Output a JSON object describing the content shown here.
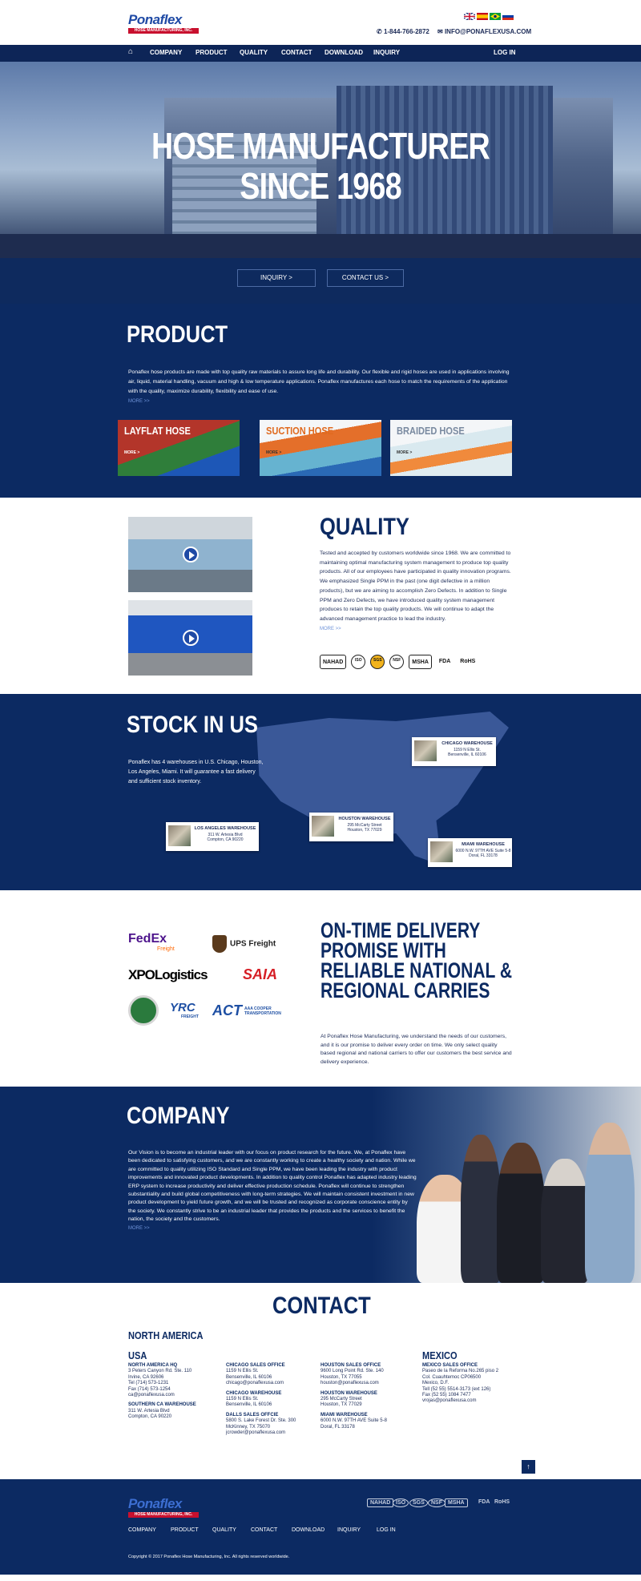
{
  "header": {
    "logo_brand": "Ponaflex",
    "logo_sub": "HOSE MANUFACTURING, INC.",
    "phone": "1-844-766-2872",
    "email": "INFO@PONAFLEXUSA.COM",
    "flags": [
      "uk",
      "spain",
      "brazil",
      "russia"
    ]
  },
  "nav": {
    "items": [
      "COMPANY",
      "PRODUCT",
      "QUALITY",
      "CONTACT",
      "DOWNLOAD",
      "INQUIRY"
    ],
    "login": "LOG IN"
  },
  "hero": {
    "line1": "HOSE MANUFACTURER",
    "line2": "SINCE 1968",
    "inquiry": "INQUIRY >",
    "contact": "CONTACT US >"
  },
  "product": {
    "title": "PRODUCT",
    "text": "Ponaflex hose products are made with top quality raw materials to assure long life and durability. Our flexible and rigid hoses are used in applications involving air, liquid, material handling, vacuum and high & low temperature applications. Ponaflex manufactures each hose to match the requirements of the application with the quality, maximize durability, flexibility and ease of use.",
    "more": "MORE >>",
    "cards": [
      {
        "label": "LAYFLAT HOSE",
        "more": "MORE >"
      },
      {
        "label": "SUCTION HOSE",
        "more": "MORE >"
      },
      {
        "label": "BRAIDED HOSE",
        "more": "MORE >"
      }
    ]
  },
  "quality": {
    "title": "QUALITY",
    "text": "Tested and accepted by customers worldwide since 1968. We are committed to maintaining optimal manufacturing system management to produce top quality products. All of our employees have participated in quality innovation programs. We emphasized Single PPM in the past (one digit defective in a million products), but we are aiming to accomplish Zero Defects. In addition to Single PPM and Zero Defects, we have introduced quality system management produces to retain the top quality products. We will continue to adapt the advanced management practice to lead the industry.",
    "more": "MORE >>",
    "certs": [
      "NAHAD",
      "ISO",
      "SGS",
      "NSF",
      "MSHA",
      "FDA",
      "RoHS"
    ]
  },
  "stock": {
    "title": "STOCK IN US",
    "text": "Ponaflex has 4 warehouses in U.S. Chicago, Houston, Los Angeles, Miami. It will guarantee a fast delivery and sufficient stock inventory.",
    "warehouses": [
      {
        "name": "CHICAGO WAREHOUSE",
        "addr1": "1159 N Ellis St.",
        "addr2": "Bensenville, IL 60106"
      },
      {
        "name": "LOS ANGELES WAREHOUSE",
        "addr1": "311 W. Artesia Blvd",
        "addr2": "Compton, CA 90220"
      },
      {
        "name": "HOUSTON WAREHOUSE",
        "addr1": "295 McCarty Street",
        "addr2": "Houston, TX 77029"
      },
      {
        "name": "MIAMI WAREHOUSE",
        "addr1": "6000 N.W. 97TH AVE Suite 5-8",
        "addr2": "Doral, FL 33178"
      }
    ]
  },
  "delivery": {
    "title": "ON-TIME DELIVERY PROMISE WITH RELIABLE NATIONAL & REGIONAL CARRIES",
    "text": "At Ponaflex Hose Manufacturing, we understand the needs of our customers, and it is our promise to deliver every order on time. We only select quality based regional and national carriers to offer our customers the best service and delivery experience.",
    "carriers": [
      "FedEx",
      "Freight",
      "UPS Freight",
      "XPOLogistics",
      "SAIA",
      "YRC",
      "FREIGHT",
      "ACT",
      "AAA COOPER TRANSPORTATION"
    ]
  },
  "company": {
    "title": "COMPANY",
    "text": "Our Vision is to become an industrial leader with our focus on product research for the future. We, at Ponaflex have been dedicated to satisfying customers, and we are constantly working to create a healthy society and nation. While we are committed to quality utilizing ISO Standard and Single PPM, we have been leading the industry with product improvements and innovated product developments. In addition to quality control Ponaflex has adapted industry leading ERP system to increase productivity and deliver effective production schedule. Ponaflex will continue to strengthen substantiality and build global competitiveness with long-term strategies. We will maintain consistent investment in new product development to yield future growth, and we will be trusted and recognized as corporate conscience entity by the society. We constantly strive to be an industrial leader that provides the products and the services to benefit the nation, the society and the customers.",
    "more": "MORE >>"
  },
  "contact": {
    "title": "CONTACT",
    "region": "NORTH AMERICA",
    "usa": "USA",
    "mexico": "MEXICO",
    "columns": [
      [
        {
          "title": "NORTH AMERICA HQ",
          "lines": [
            "3 Peters Canyon Rd. Ste. 110",
            "Irvine, CA 92606",
            "Tel (714) 573-1231",
            "Fax (714) 573-1254",
            "ca@ponaflexusa.com"
          ]
        },
        {
          "title": "SOUTHERN CA WAREHOUSE",
          "lines": [
            "311 W. Artesia Blvd",
            "Compton, CA 90220"
          ]
        }
      ],
      [
        {
          "title": "CHICAGO SALES OFFICE",
          "lines": [
            "1159 N Ellis St.",
            "Bensenville, IL 60106",
            "chicago@ponaflexusa.com"
          ]
        },
        {
          "title": "CHICAGO WAREHOUSE",
          "lines": [
            "1159 N Ellis St.",
            "Bensenville, IL 60106"
          ]
        },
        {
          "title": "DALLS SALES OFFCIE",
          "lines": [
            "5800 S. Lake Forest Dr. Ste. 300",
            "McKinney, TX 75070",
            "jcrowder@ponaflexusa.com"
          ]
        }
      ],
      [
        {
          "title": "HOUSTON SALES OFFICE",
          "lines": [
            "9600 Long Point Rd. Ste. 140",
            "Houston, TX 77055",
            "houston@ponaflexusa.com"
          ]
        },
        {
          "title": "HOUSTON WAREHOUSE",
          "lines": [
            "295 McCarty Street",
            "Houston, TX 77029"
          ]
        },
        {
          "title": "MIAMI WAREHOUSE",
          "lines": [
            "6000 N.W. 97TH AVE Suite 5-8",
            "Doral, FL 33178"
          ]
        }
      ],
      [
        {
          "title": "MEXICO SALES OFFICE",
          "lines": [
            "Paseo de la Reforma No.265 piso 2",
            "Col. Cuauhtemoc CP06500",
            "Mexico, D.F.",
            "Tell (52 55) 5514-3173 (ext 126)",
            "Fax (52 55) 1084 7477",
            "vrojas@ponaflexusa.com"
          ]
        }
      ]
    ]
  },
  "footer": {
    "links": [
      "COMPANY",
      "PRODUCT",
      "QUALITY",
      "CONTACT",
      "DOWNLOAD",
      "INQUIRY",
      "LOG IN"
    ],
    "certs": [
      "NAHAD",
      "ISO",
      "SGS",
      "NSF",
      "MSHA",
      "FDA",
      "RoHS"
    ],
    "copyright": "Copyright © 2017 Ponaflex Hose Manufacturing, Inc. All rights reserved worldwide."
  }
}
